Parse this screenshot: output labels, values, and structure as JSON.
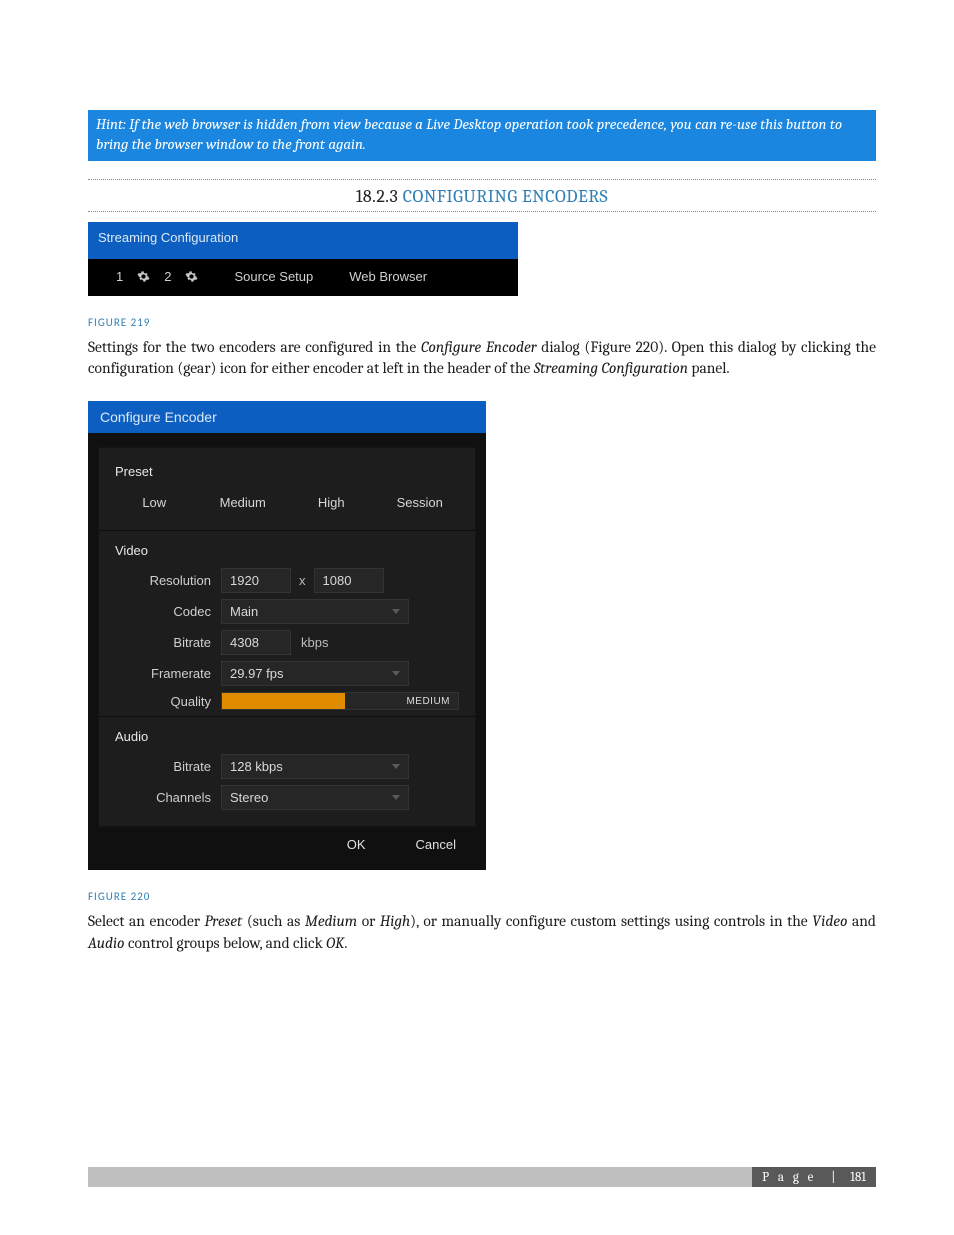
{
  "callout": "Hint: If the web browser is hidden from view because a Live Desktop operation took precedence, you can re-use this button to bring the browser window to the front again.",
  "section": {
    "number": "18.2.3",
    "title": "CONFIGURING ENCODERS"
  },
  "streamconf": {
    "title": "Streaming Configuration",
    "enc1": "1",
    "enc2": "2",
    "source_setup": "Source Setup",
    "web_browser": "Web Browser"
  },
  "fig219": "FIGURE 219",
  "para1_a": "Settings for the two encoders are configured in the ",
  "para1_b": "Configure Encoder",
  "para1_c": " dialog (Figure 220).  Open this dialog by clicking the configuration (gear) icon for either encoder at left in the header of the ",
  "para1_d": "Streaming Configuration",
  "para1_e": " panel.",
  "dialog": {
    "title": "Configure Encoder",
    "preset_label": "Preset",
    "presets": {
      "low": "Low",
      "medium": "Medium",
      "high": "High",
      "session": "Session"
    },
    "video_label": "Video",
    "resolution_label": "Resolution",
    "res_w": "1920",
    "res_sep": "x",
    "res_h": "1080",
    "codec_label": "Codec",
    "codec_value": "Main",
    "bitrate_label": "Bitrate",
    "bitrate_value": "4308",
    "bitrate_unit": "kbps",
    "framerate_label": "Framerate",
    "framerate_value": "29.97 fps",
    "quality_label": "Quality",
    "quality_value": "MEDIUM",
    "quality_fill_pct": 52,
    "audio_label": "Audio",
    "abitrate_label": "Bitrate",
    "abitrate_value": "128 kbps",
    "channels_label": "Channels",
    "channels_value": "Stereo",
    "ok": "OK",
    "cancel": "Cancel"
  },
  "fig220": "FIGURE 220",
  "para2_a": "Select an encoder ",
  "para2_b": "Preset",
  "para2_c": " (such as ",
  "para2_d": "Medium",
  "para2_e": " or ",
  "para2_f": "High",
  "para2_g": "), or manually configure custom settings using controls in the ",
  "para2_h": "Video",
  "para2_i": " and ",
  "para2_j": "Audio",
  "para2_k": " control groups below, and click ",
  "para2_l": "OK",
  "para2_m": ".",
  "footer": {
    "label": "P a g e",
    "sep": "|",
    "num": "181"
  }
}
